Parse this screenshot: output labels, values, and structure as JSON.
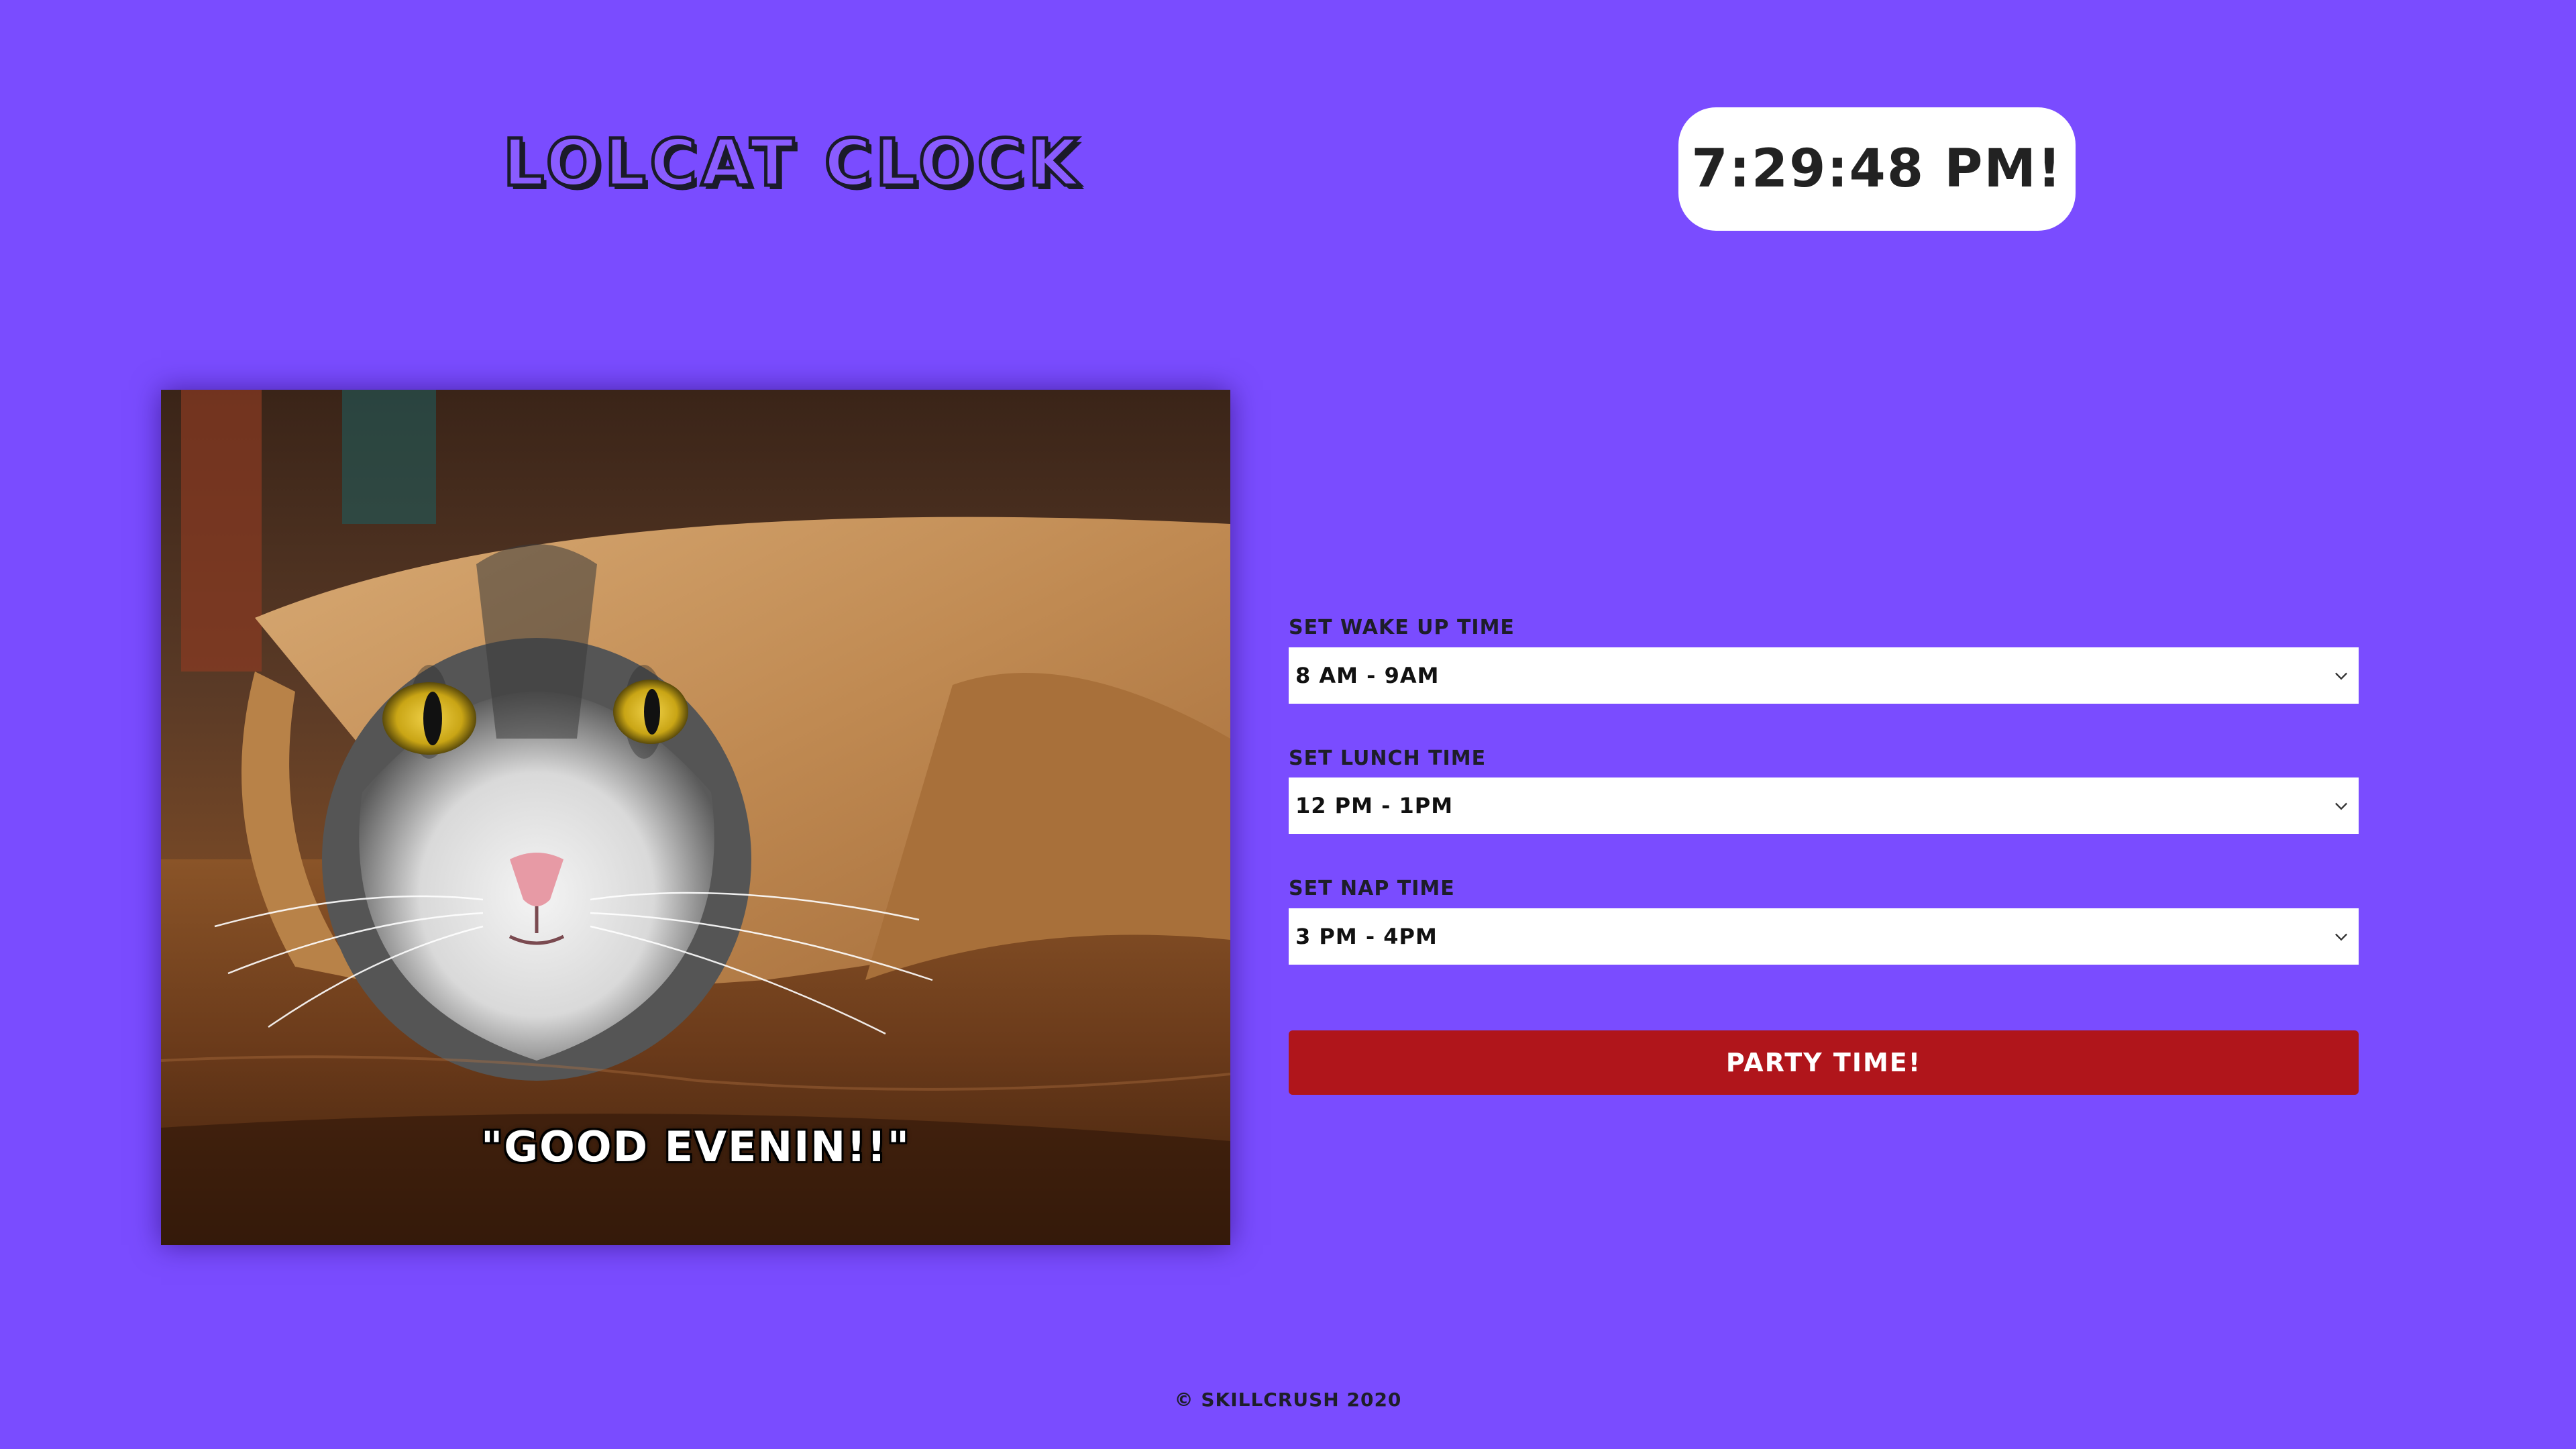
{
  "header": {
    "title": "LOLCAT CLOCK"
  },
  "clock": {
    "time": "7:29:48 PM!"
  },
  "photo": {
    "caption": "\"GOOD EVENIN!!\""
  },
  "controls": {
    "wakeup": {
      "label": "SET WAKE UP TIME",
      "value": "8 AM - 9AM"
    },
    "lunch": {
      "label": "SET LUNCH TIME",
      "value": "12 PM - 1PM"
    },
    "nap": {
      "label": "SET NAP TIME",
      "value": "3 PM - 4PM"
    },
    "party_button": "PARTY TIME!"
  },
  "footer": {
    "text": "© SKILLCRUSH 2020"
  },
  "colors": {
    "background": "#7a4cff",
    "button": "#b0151b",
    "text_dark": "#1e1e2a"
  }
}
